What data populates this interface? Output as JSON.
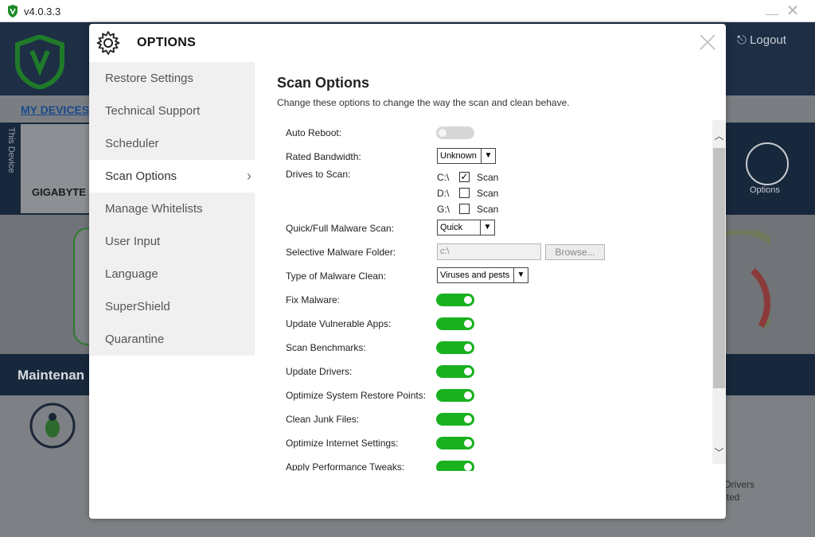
{
  "titlebar": {
    "version": "v4.0.3.3"
  },
  "background": {
    "logout": "Logout",
    "my_devices": "MY DEVICES",
    "this_device": "This Device",
    "device_name": "GIGABYTE",
    "options_label": "Options",
    "maintenance": "Maintenan",
    "drivers_line1": "Drivers",
    "drivers_line2": "ited"
  },
  "modal": {
    "title": "OPTIONS",
    "sidebar": [
      {
        "label": "Restore Settings",
        "active": false
      },
      {
        "label": "Technical Support",
        "active": false
      },
      {
        "label": "Scheduler",
        "active": false
      },
      {
        "label": "Scan Options",
        "active": true
      },
      {
        "label": "Manage Whitelists",
        "active": false
      },
      {
        "label": "User Input",
        "active": false
      },
      {
        "label": "Language",
        "active": false
      },
      {
        "label": "SuperShield",
        "active": false
      },
      {
        "label": "Quarantine",
        "active": false
      }
    ],
    "content": {
      "title": "Scan Options",
      "description": "Change these options to change the way the scan and clean behave.",
      "auto_reboot": {
        "label": "Auto Reboot:",
        "on": false
      },
      "rated_bandwidth": {
        "label": "Rated Bandwidth:",
        "value": "Unknown"
      },
      "drives": {
        "label": "Drives to Scan:",
        "items": [
          {
            "letter": "C:\\",
            "checked": true,
            "text": "Scan"
          },
          {
            "letter": "D:\\",
            "checked": false,
            "text": "Scan"
          },
          {
            "letter": "G:\\",
            "checked": false,
            "text": "Scan"
          }
        ]
      },
      "malware_scan": {
        "label": "Quick/Full Malware Scan:",
        "value": "Quick"
      },
      "malware_folder": {
        "label": "Selective Malware Folder:",
        "value": "c:\\",
        "browse": "Browse..."
      },
      "malware_clean": {
        "label": "Type of Malware Clean:",
        "value": "Viruses and pests"
      },
      "toggles": [
        {
          "label": "Fix Malware:",
          "on": true
        },
        {
          "label": "Update Vulnerable Apps:",
          "on": true
        },
        {
          "label": "Scan Benchmarks:",
          "on": true
        },
        {
          "label": "Update Drivers:",
          "on": true
        },
        {
          "label": "Optimize System Restore Points:",
          "on": true
        },
        {
          "label": "Clean Junk Files:",
          "on": true
        },
        {
          "label": "Optimize Internet Settings:",
          "on": true
        },
        {
          "label": "Apply Performance Tweaks:",
          "on": true
        }
      ]
    }
  },
  "colors": {
    "accent_green": "#19b11f",
    "navy": "#1d2e45"
  }
}
